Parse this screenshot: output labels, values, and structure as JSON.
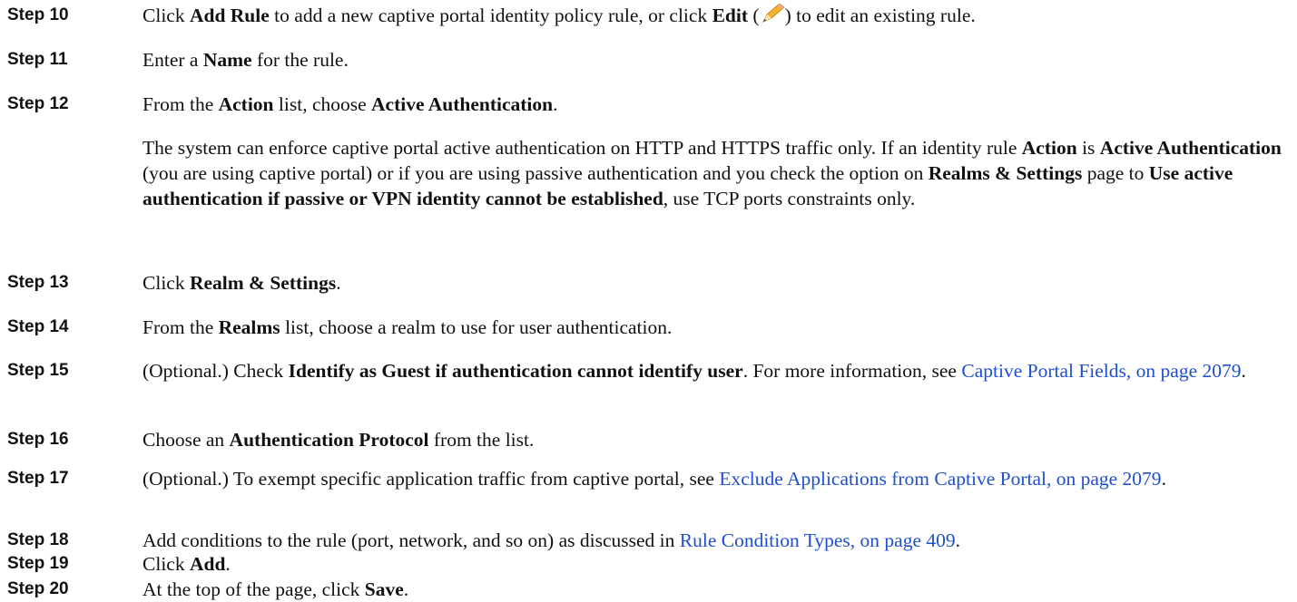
{
  "steps": [
    {
      "label": "Step 10",
      "t1": "Click ",
      "b1": "Add Rule",
      "t2": " to add a new captive portal identity policy rule, or click ",
      "b2": "Edit",
      "t3": " (",
      "t4": ") to edit an existing rule.",
      "icon": "pencil-edit-icon"
    },
    {
      "label": "Step 11",
      "t1": "Enter a ",
      "b1": "Name",
      "t2": " for the rule."
    },
    {
      "label": "Step 12",
      "t1": "From the ",
      "b1": "Action",
      "t2": " list, choose ",
      "b2": "Active Authentication",
      "t3": ".",
      "note": {
        "t1": "The system can enforce captive portal active authentication on HTTP and HTTPS traffic only. If an identity rule ",
        "b1": "Action",
        "t2": " is ",
        "b2": "Active Authentication",
        "t3": " (you are using captive portal) or if you are using passive authentication and you check the option on ",
        "b3": "Realms & Settings",
        "t4": " page to ",
        "b4": "Use active authentication if passive or VPN identity cannot be established",
        "t5": ", use TCP ports constraints only."
      }
    },
    {
      "label": "Step 13",
      "t1": "Click ",
      "b1": "Realm & Settings",
      "t2": "."
    },
    {
      "label": "Step 14",
      "t1": "From the ",
      "b1": "Realms",
      "t2": " list, choose a realm to use for user authentication."
    },
    {
      "label": "Step 15",
      "t1": "(Optional.) Check ",
      "b1": "Identify as Guest if authentication cannot identify user",
      "t2": ". For more information, see ",
      "link": "Captive Portal Fields, on page 2079",
      "t3": "."
    },
    {
      "label": "Step 16",
      "t1": "Choose an ",
      "b1": "Authentication Protocol",
      "t2": " from the list."
    },
    {
      "label": "Step 17",
      "t1": "(Optional.) To exempt specific application traffic from captive portal, see ",
      "link": "Exclude Applications from Captive Portal, on page 2079",
      "t2": "."
    },
    {
      "label": "Step 18",
      "t1": "Add conditions to the rule (port, network, and so on) as discussed in ",
      "link": "Rule Condition Types, on page 409",
      "t2": "."
    },
    {
      "label": "Step 19",
      "t1": "Click ",
      "b1": "Add",
      "t2": "."
    },
    {
      "label": "Step 20",
      "t1": "At the top of the page, click ",
      "b1": "Save",
      "t2": "."
    }
  ],
  "colors": {
    "link": "#1f4fd1",
    "text": "#111111"
  }
}
